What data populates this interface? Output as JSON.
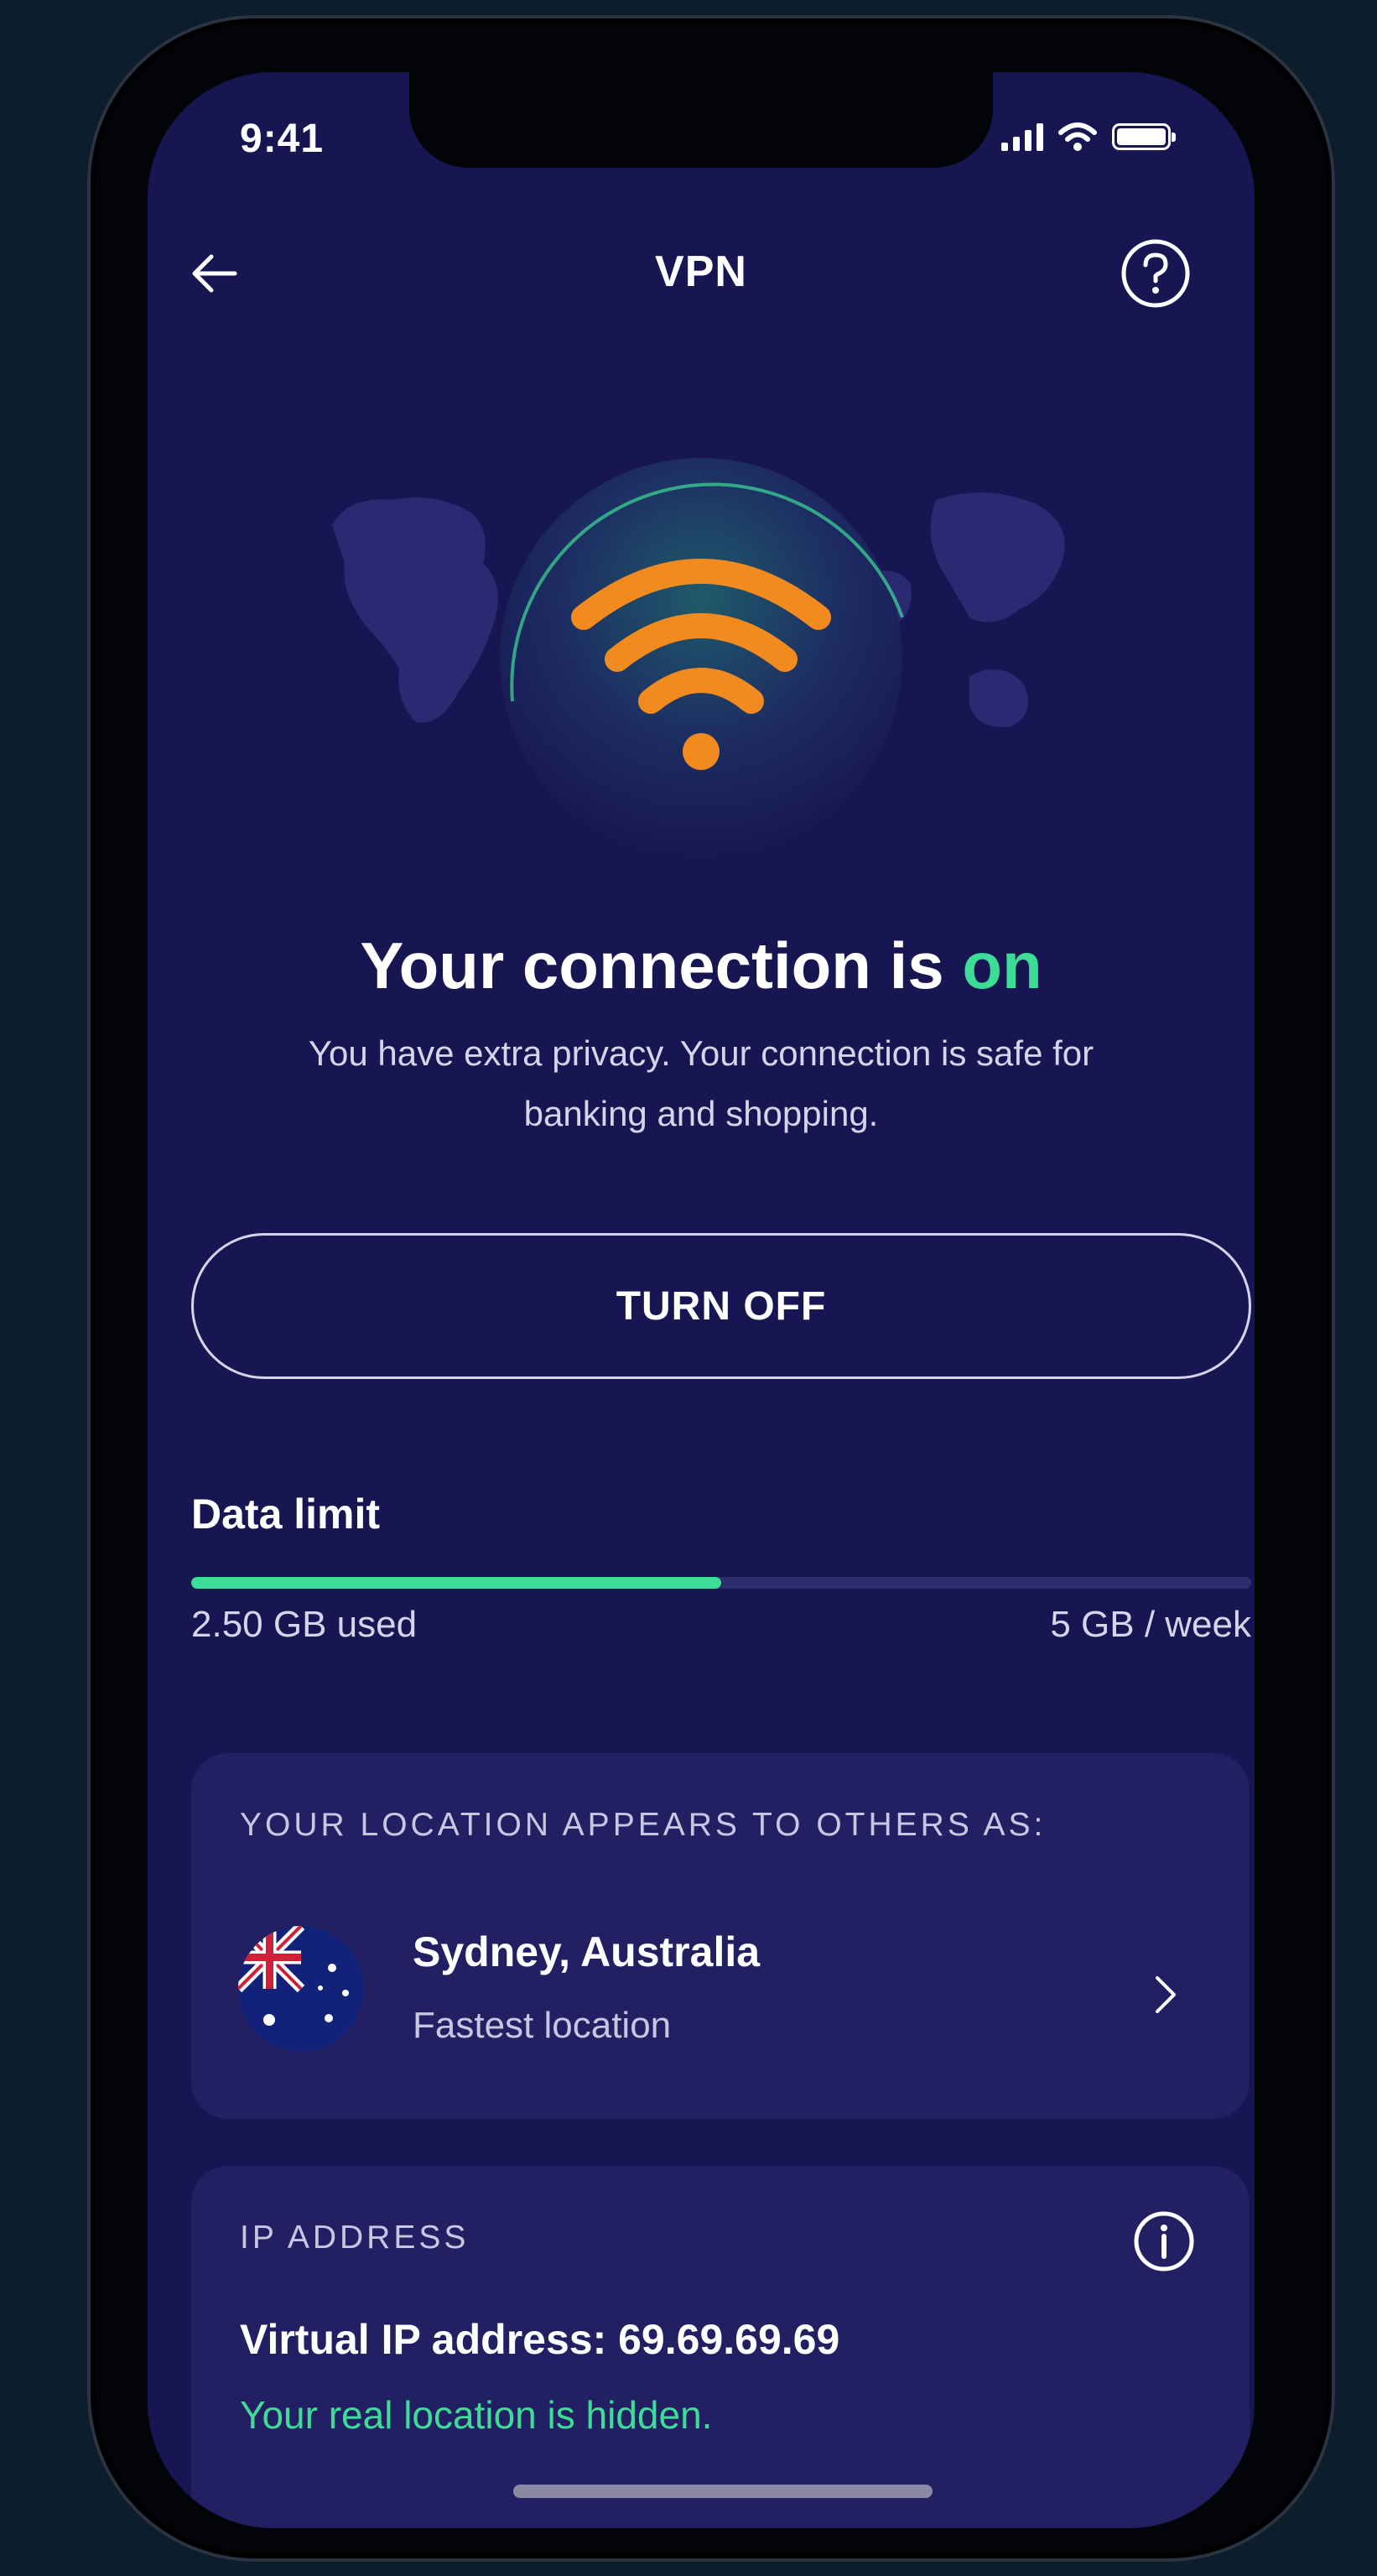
{
  "status_bar": {
    "time": "9:41"
  },
  "header": {
    "title": "VPN"
  },
  "hero": {
    "headline_prefix": "Your connection is ",
    "headline_status": "on",
    "subtitle": "You have extra privacy. Your connection is safe for banking and shopping."
  },
  "actions": {
    "turn_off_label": "TURN OFF"
  },
  "data_limit": {
    "title": "Data limit",
    "used_label": "2.50 GB used",
    "limit_label": "5 GB / week",
    "used_fraction": 0.5
  },
  "location_card": {
    "caption": "YOUR LOCATION APPEARS TO OTHERS AS:",
    "location": "Sydney, Australia",
    "subtitle": "Fastest location",
    "flag": "australia-flag"
  },
  "ip_card": {
    "caption": "IP ADDRESS",
    "virtual_ip": "Virtual IP address: 69.69.69.69",
    "note": "Your real location is hidden."
  },
  "colors": {
    "background": "#181652",
    "card": "#231f63",
    "accent_green": "#3ddc97",
    "accent_orange": "#f28b1f"
  },
  "icons": [
    "back-arrow-icon",
    "help-icon",
    "wifi-icon",
    "chevron-right-icon",
    "info-icon"
  ]
}
